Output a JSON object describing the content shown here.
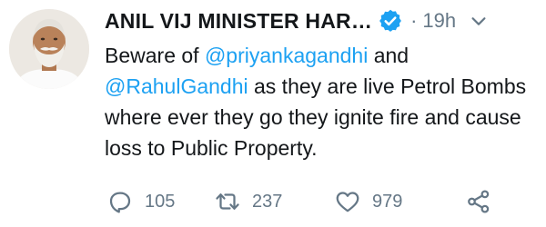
{
  "author": {
    "name": "ANIL VIJ MINISTER HAR…",
    "verified": true
  },
  "timestamp": "19h",
  "separator": "·",
  "tweet": {
    "prefix": "Beware of ",
    "mention1": "@priyankagandhi",
    "mid": " and ",
    "mention2": "@RahulGandhi",
    "suffix": " as they are live Petrol Bombs where ever they go they ignite fire and cause loss to Public Property."
  },
  "actions": {
    "replies": "105",
    "retweets": "237",
    "likes": "979"
  },
  "icons": {
    "reply": "reply-icon",
    "retweet": "retweet-icon",
    "like": "heart-icon",
    "share": "share-icon",
    "verified": "verified-badge-icon",
    "caret": "chevron-down-icon"
  },
  "colors": {
    "mention": "#1da1f2",
    "verified": "#1da1f2",
    "muted": "#657786",
    "text": "#14171a"
  }
}
